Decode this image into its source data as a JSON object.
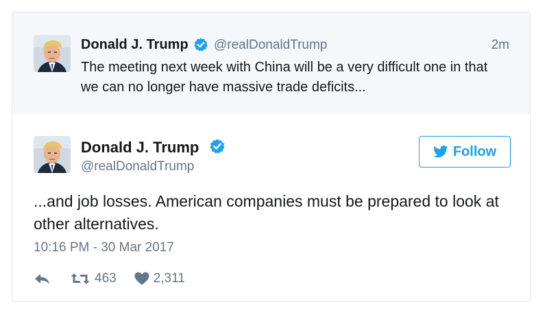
{
  "parent_tweet": {
    "author_name": "Donald J. Trump",
    "handle": "@realDonaldTrump",
    "time_ago": "2m",
    "text": "The meeting next week with China will be a very difficult one in that we can no longer have massive trade deficits...",
    "verified": true
  },
  "main_tweet": {
    "author_name": "Donald J. Trump",
    "handle": "@realDonaldTrump",
    "verified": true,
    "follow_label": "Follow",
    "text": "...and job losses. American companies must be prepared to look at other alternatives.",
    "timestamp": "10:16 PM - 30 Mar 2017",
    "retweet_count": "463",
    "like_count": "2,311"
  },
  "icons": {
    "verified": "verified-badge-icon",
    "follow": "twitter-bird-icon",
    "reply": "reply-icon",
    "retweet": "retweet-icon",
    "like": "heart-icon"
  },
  "colors": {
    "accent": "#1da1f2",
    "secondary_text": "#657786",
    "parent_bg": "#f5f8fa",
    "border": "#e1e8ed"
  }
}
